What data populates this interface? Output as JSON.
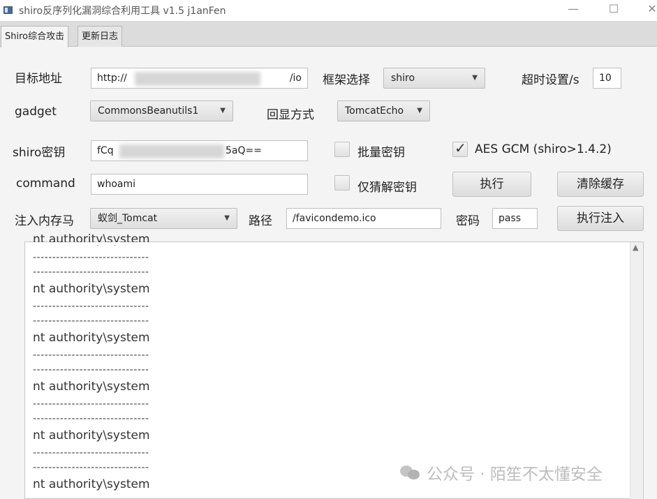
{
  "window": {
    "title": "shiro反序列化漏洞综合利用工具 v1.5  j1anFen",
    "minimize_glyph": "—",
    "maximize_glyph": "☐",
    "close_glyph": "✕"
  },
  "tabs": [
    {
      "label": "Shiro综合攻击",
      "active": true
    },
    {
      "label": "更新日志",
      "active": false
    }
  ],
  "form": {
    "target_label": "目标地址",
    "target_value_start": "http://",
    "target_value_end": "/io",
    "framework_label": "框架选择",
    "framework_value": "shiro",
    "timeout_label": "超时设置/s",
    "timeout_value": "10",
    "gadget_label": "gadget",
    "gadget_value": "CommonsBeanutils1",
    "echo_label": "回显方式",
    "echo_value": "TomcatEcho",
    "key_label": "shiro密钥",
    "key_value_start": "fCq",
    "key_value_end": "5aQ==",
    "batch_key_label": "批量密钥",
    "aes_gcm_label": "AES GCM (shiro>1.4.2)",
    "command_label": "command",
    "command_value": "whoami",
    "guess_key_label": "仅猜解密钥",
    "execute_label": "执行",
    "clear_cache_label": "清除缓存",
    "memshell_label": "注入内存马",
    "memshell_value": "蚁剑_Tomcat",
    "path_label": "路径",
    "path_value": "/favicondemo.ico",
    "password_label": "密码",
    "password_value": "pass",
    "inject_label": "执行注入"
  },
  "checkboxes": {
    "batch_key": false,
    "aes_gcm": true,
    "guess_key": false
  },
  "icons": {
    "dropdown": "chevron-down-icon",
    "checked": "checkmark-icon",
    "scroll_up": "scroll-up-icon",
    "wechat": "wechat-icon"
  },
  "output": {
    "separator": "------------------------------",
    "lines": [
      "nt authority\\system",
      "nt authority\\system",
      "nt authority\\system",
      "nt authority\\system",
      "nt authority\\system",
      "nt authority\\system"
    ]
  },
  "watermark": {
    "text": "公众号 · 陌笙不太懂安全"
  }
}
